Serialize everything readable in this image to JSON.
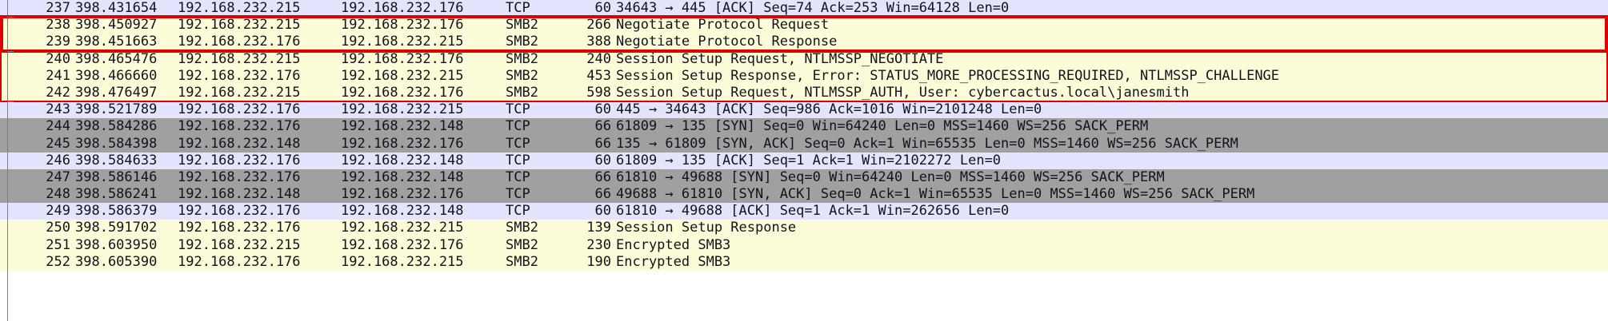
{
  "colors": {
    "tcp_light": "#e5e4ff",
    "tcp_dark": "#a0a0a0",
    "smb": "#fcfcd9",
    "highlight": "#e10000"
  },
  "rows": [
    {
      "no": "237",
      "time": "398.431654",
      "src": "192.168.232.215",
      "dst": "192.168.232.176",
      "proto": "TCP",
      "len": "60",
      "info": "34643 → 445 [ACK] Seq=74 Ack=253 Win=64128 Len=0",
      "style": "tcp_light"
    },
    {
      "no": "238",
      "time": "398.450927",
      "src": "192.168.232.215",
      "dst": "192.168.232.176",
      "proto": "SMB2",
      "len": "266",
      "info": "Negotiate Protocol Request",
      "style": "smb"
    },
    {
      "no": "239",
      "time": "398.451663",
      "src": "192.168.232.176",
      "dst": "192.168.232.215",
      "proto": "SMB2",
      "len": "388",
      "info": "Negotiate Protocol Response",
      "style": "smb"
    },
    {
      "no": "240",
      "time": "398.465476",
      "src": "192.168.232.215",
      "dst": "192.168.232.176",
      "proto": "SMB2",
      "len": "240",
      "info": "Session Setup Request, NTLMSSP_NEGOTIATE",
      "style": "smb"
    },
    {
      "no": "241",
      "time": "398.466660",
      "src": "192.168.232.176",
      "dst": "192.168.232.215",
      "proto": "SMB2",
      "len": "453",
      "info": "Session Setup Response, Error: STATUS_MORE_PROCESSING_REQUIRED, NTLMSSP_CHALLENGE",
      "style": "smb"
    },
    {
      "no": "242",
      "time": "398.476497",
      "src": "192.168.232.215",
      "dst": "192.168.232.176",
      "proto": "SMB2",
      "len": "598",
      "info": "Session Setup Request, NTLMSSP_AUTH, User: cybercactus.local\\janesmith",
      "style": "smb"
    },
    {
      "no": "243",
      "time": "398.521789",
      "src": "192.168.232.176",
      "dst": "192.168.232.215",
      "proto": "TCP",
      "len": "60",
      "info": "445 → 34643 [ACK] Seq=986 Ack=1016 Win=2101248 Len=0",
      "style": "tcp_light"
    },
    {
      "no": "244",
      "time": "398.584286",
      "src": "192.168.232.176",
      "dst": "192.168.232.148",
      "proto": "TCP",
      "len": "66",
      "info": "61809 → 135 [SYN] Seq=0 Win=64240 Len=0 MSS=1460 WS=256 SACK_PERM",
      "style": "tcp_dark"
    },
    {
      "no": "245",
      "time": "398.584398",
      "src": "192.168.232.148",
      "dst": "192.168.232.176",
      "proto": "TCP",
      "len": "66",
      "info": "135 → 61809 [SYN, ACK] Seq=0 Ack=1 Win=65535 Len=0 MSS=1460 WS=256 SACK_PERM",
      "style": "tcp_dark"
    },
    {
      "no": "246",
      "time": "398.584633",
      "src": "192.168.232.176",
      "dst": "192.168.232.148",
      "proto": "TCP",
      "len": "60",
      "info": "61809 → 135 [ACK] Seq=1 Ack=1 Win=2102272 Len=0",
      "style": "tcp_light"
    },
    {
      "no": "247",
      "time": "398.586146",
      "src": "192.168.232.176",
      "dst": "192.168.232.148",
      "proto": "TCP",
      "len": "66",
      "info": "61810 → 49688 [SYN] Seq=0 Win=64240 Len=0 MSS=1460 WS=256 SACK_PERM",
      "style": "tcp_dark"
    },
    {
      "no": "248",
      "time": "398.586241",
      "src": "192.168.232.148",
      "dst": "192.168.232.176",
      "proto": "TCP",
      "len": "66",
      "info": "49688 → 61810 [SYN, ACK] Seq=0 Ack=1 Win=65535 Len=0 MSS=1460 WS=256 SACK_PERM",
      "style": "tcp_dark"
    },
    {
      "no": "249",
      "time": "398.586379",
      "src": "192.168.232.176",
      "dst": "192.168.232.148",
      "proto": "TCP",
      "len": "60",
      "info": "61810 → 49688 [ACK] Seq=1 Ack=1 Win=262656 Len=0",
      "style": "tcp_light"
    },
    {
      "no": "250",
      "time": "398.591702",
      "src": "192.168.232.176",
      "dst": "192.168.232.215",
      "proto": "SMB2",
      "len": "139",
      "info": "Session Setup Response",
      "style": "smb"
    },
    {
      "no": "251",
      "time": "398.603950",
      "src": "192.168.232.215",
      "dst": "192.168.232.176",
      "proto": "SMB2",
      "len": "230",
      "info": "Encrypted SMB3",
      "style": "smb"
    },
    {
      "no": "252",
      "time": "398.605390",
      "src": "192.168.232.176",
      "dst": "192.168.232.215",
      "proto": "SMB2",
      "len": "190",
      "info": "Encrypted SMB3",
      "style": "smb"
    }
  ]
}
